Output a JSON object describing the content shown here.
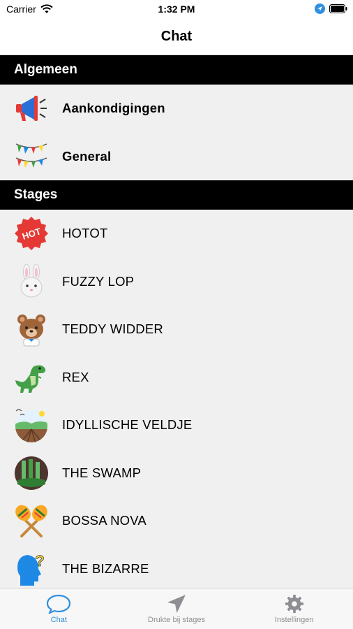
{
  "status_bar": {
    "carrier": "Carrier",
    "time": "1:32 PM"
  },
  "nav": {
    "title": "Chat"
  },
  "sections": [
    {
      "title": "Algemeen",
      "rows": [
        {
          "label": "Aankondigingen",
          "icon": "megaphone-icon"
        },
        {
          "label": "General",
          "icon": "bunting-icon"
        }
      ]
    },
    {
      "title": "Stages",
      "rows": [
        {
          "label": "HOTOT",
          "icon": "hot-badge-icon"
        },
        {
          "label": "FUZZY LOP",
          "icon": "bunny-icon"
        },
        {
          "label": "TEDDY WIDDER",
          "icon": "teddy-bear-icon"
        },
        {
          "label": "REX",
          "icon": "dinosaur-icon"
        },
        {
          "label": "IDYLLISCHE VELDJE",
          "icon": "field-icon"
        },
        {
          "label": "THE SWAMP",
          "icon": "swamp-icon"
        },
        {
          "label": "BOSSA NOVA",
          "icon": "maracas-icon"
        },
        {
          "label": "THE BIZARRE",
          "icon": "question-head-icon"
        }
      ]
    }
  ],
  "tabs": [
    {
      "label": "Chat",
      "icon": "chat-bubble-icon",
      "active": true
    },
    {
      "label": "Drukte bij stages",
      "icon": "location-arrow-icon",
      "active": false
    },
    {
      "label": "Instellingen",
      "icon": "gear-icon",
      "active": false
    }
  ],
  "colors": {
    "accent": "#2f8fe0",
    "section_header_bg": "#000000",
    "list_bg": "#f0f0f0"
  }
}
